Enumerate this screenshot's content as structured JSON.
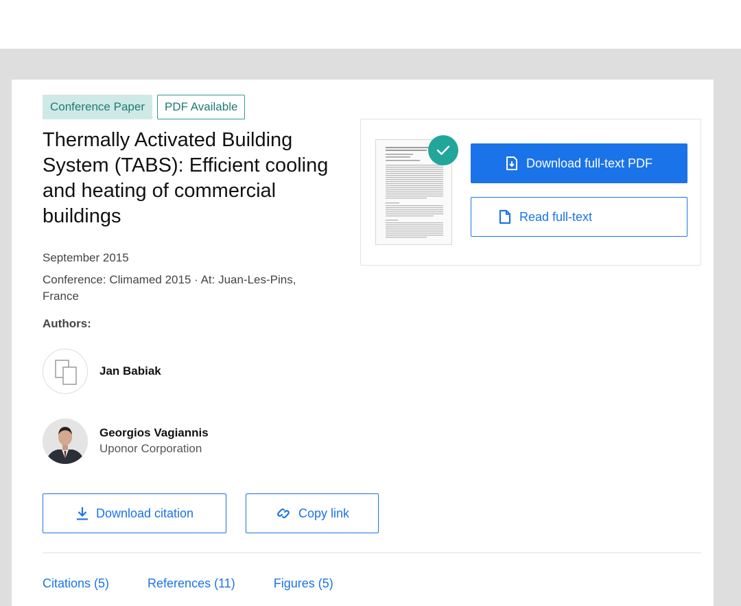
{
  "publication": {
    "type_badge": "Conference Paper",
    "pdf_badge": "PDF Available",
    "title": "Thermally Activated Building System (TABS): Efficient cooling and heating of commercial buildings",
    "date": "September 2015",
    "conference": "Conference: Climamed 2015 · At: Juan-Les-Pins, France",
    "authors_label": "Authors:"
  },
  "authors": [
    {
      "name": "Jan Babiak",
      "institution": "",
      "avatar": "placeholder-avatar-icon"
    },
    {
      "name": "Georgios Vagiannis",
      "institution": "Uponor Corporation",
      "avatar": "photo"
    }
  ],
  "actions": {
    "download_citation": "Download citation",
    "copy_link": "Copy link"
  },
  "fulltext": {
    "download_pdf": "Download full-text PDF",
    "read_fulltext": "Read full-text"
  },
  "tabs": [
    {
      "label": "Citations (5)"
    },
    {
      "label": "References (11)"
    },
    {
      "label": "Figures (5)"
    }
  ],
  "colors": {
    "accent": "#1a73e8",
    "badge_teal": "#1f7a73",
    "check_green": "#22a69a",
    "page_background": "#dedede"
  }
}
